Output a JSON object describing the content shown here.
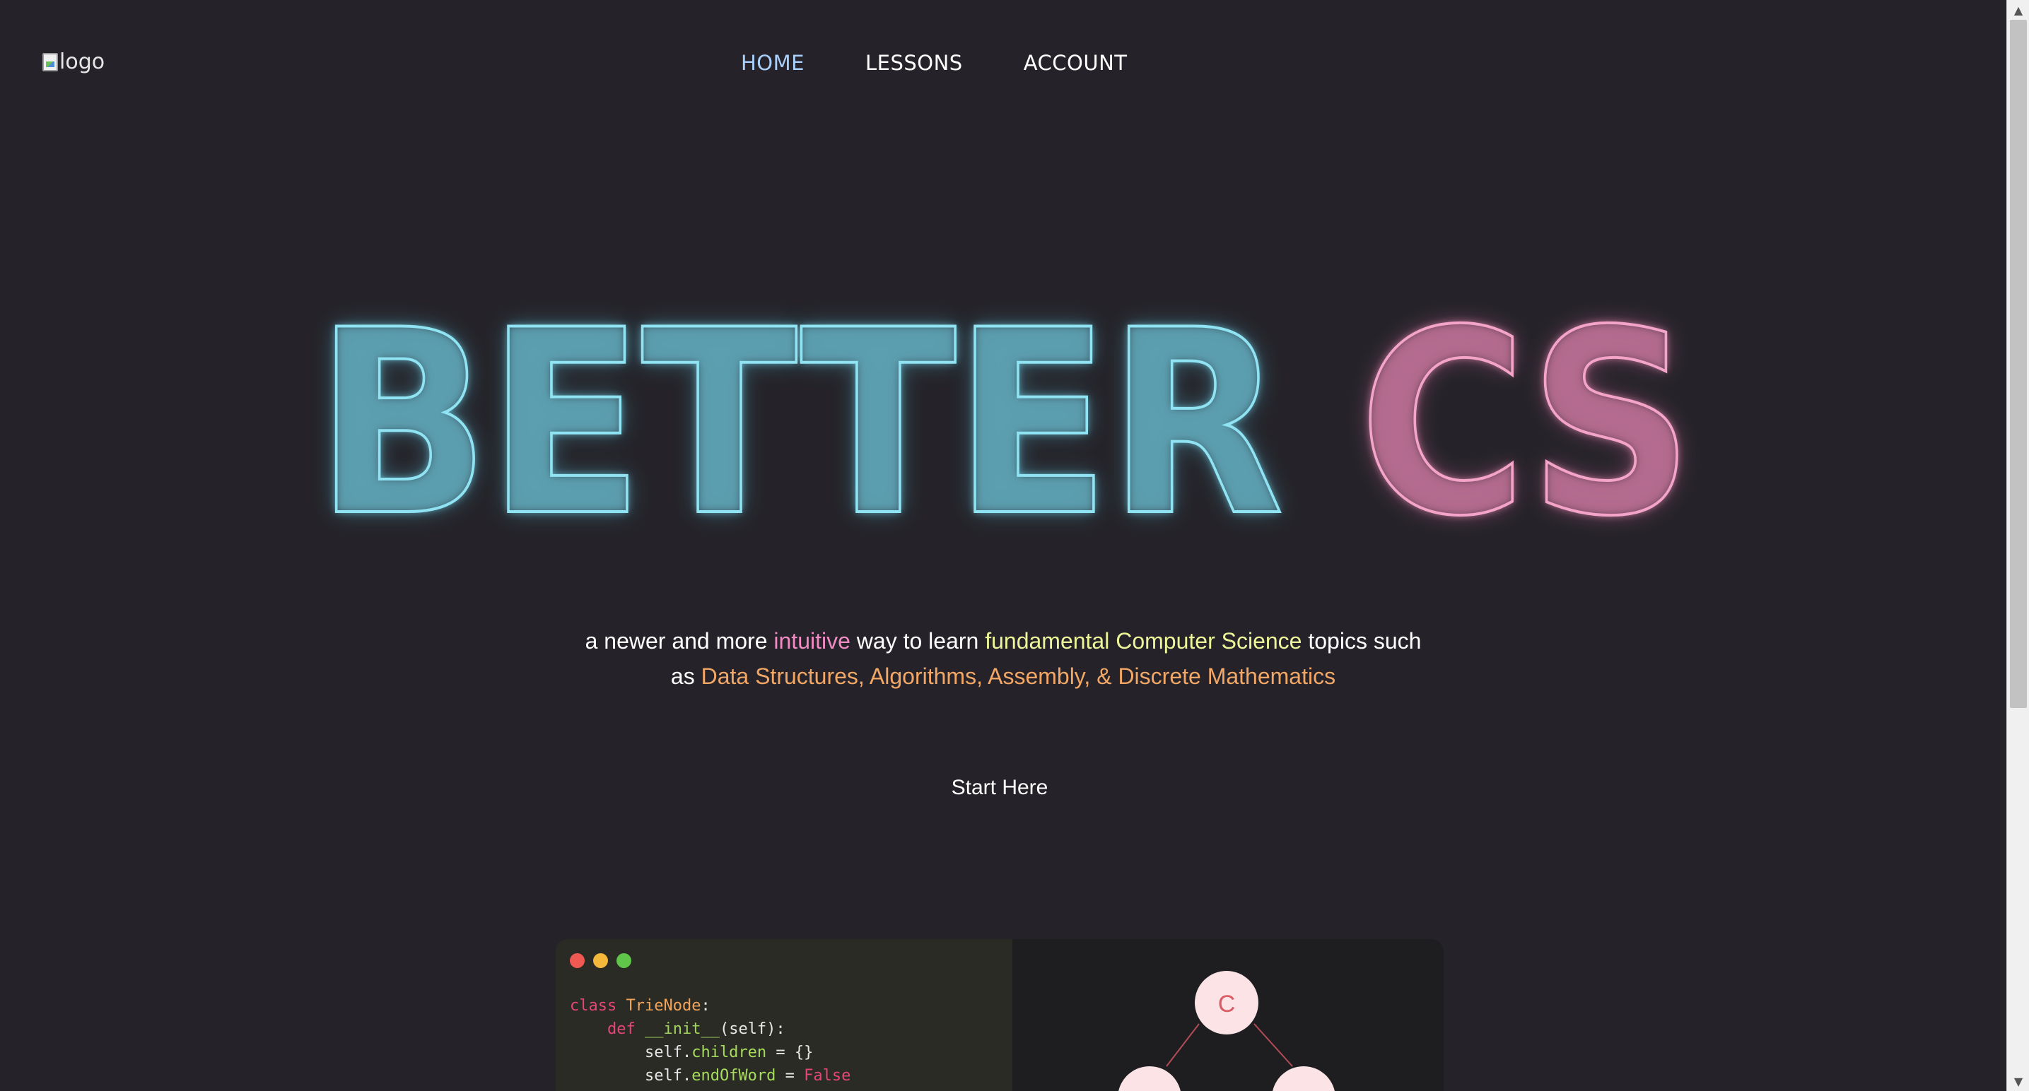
{
  "header": {
    "logo_alt": "logo",
    "nav": {
      "home": "HOME",
      "lessons": "LESSONS",
      "account": "ACCOUNT"
    }
  },
  "hero": {
    "title_part1": "BETTER",
    "title_part2": "CS",
    "tagline": {
      "t1": "a newer and more ",
      "h1": "intuitive",
      "t2": " way to learn ",
      "h2": "fundamental Computer Science",
      "t3": " topics such",
      "t4": "as ",
      "h3": "Data Structures, Algorithms, Assembly, & Discrete Mathematics"
    },
    "cta_label": "Start Here"
  },
  "demo": {
    "code": {
      "l1_kw": "class",
      "l1_name": "TrieNode",
      "l1_end": ":",
      "l2_kw": "def",
      "l2_fn": "__init__",
      "l2_end": "(self):",
      "l3_self": "self",
      "l3_attr": "children",
      "l3_end": " = {}",
      "l4_self": "self",
      "l4_attr": "endOfWord",
      "l4_eq": " = ",
      "l4_val": "False"
    },
    "tree": {
      "root_label": "C"
    }
  },
  "colors": {
    "background": "#252329",
    "nav_active": "#a9cffb",
    "better_stroke": "#8fe3f2",
    "cs_stroke": "#f3a4c8",
    "highlight_pink": "#f08bc4",
    "highlight_yellow": "#ecf59a",
    "highlight_orange": "#f2a766",
    "node_fill": "#fbe3e6"
  }
}
